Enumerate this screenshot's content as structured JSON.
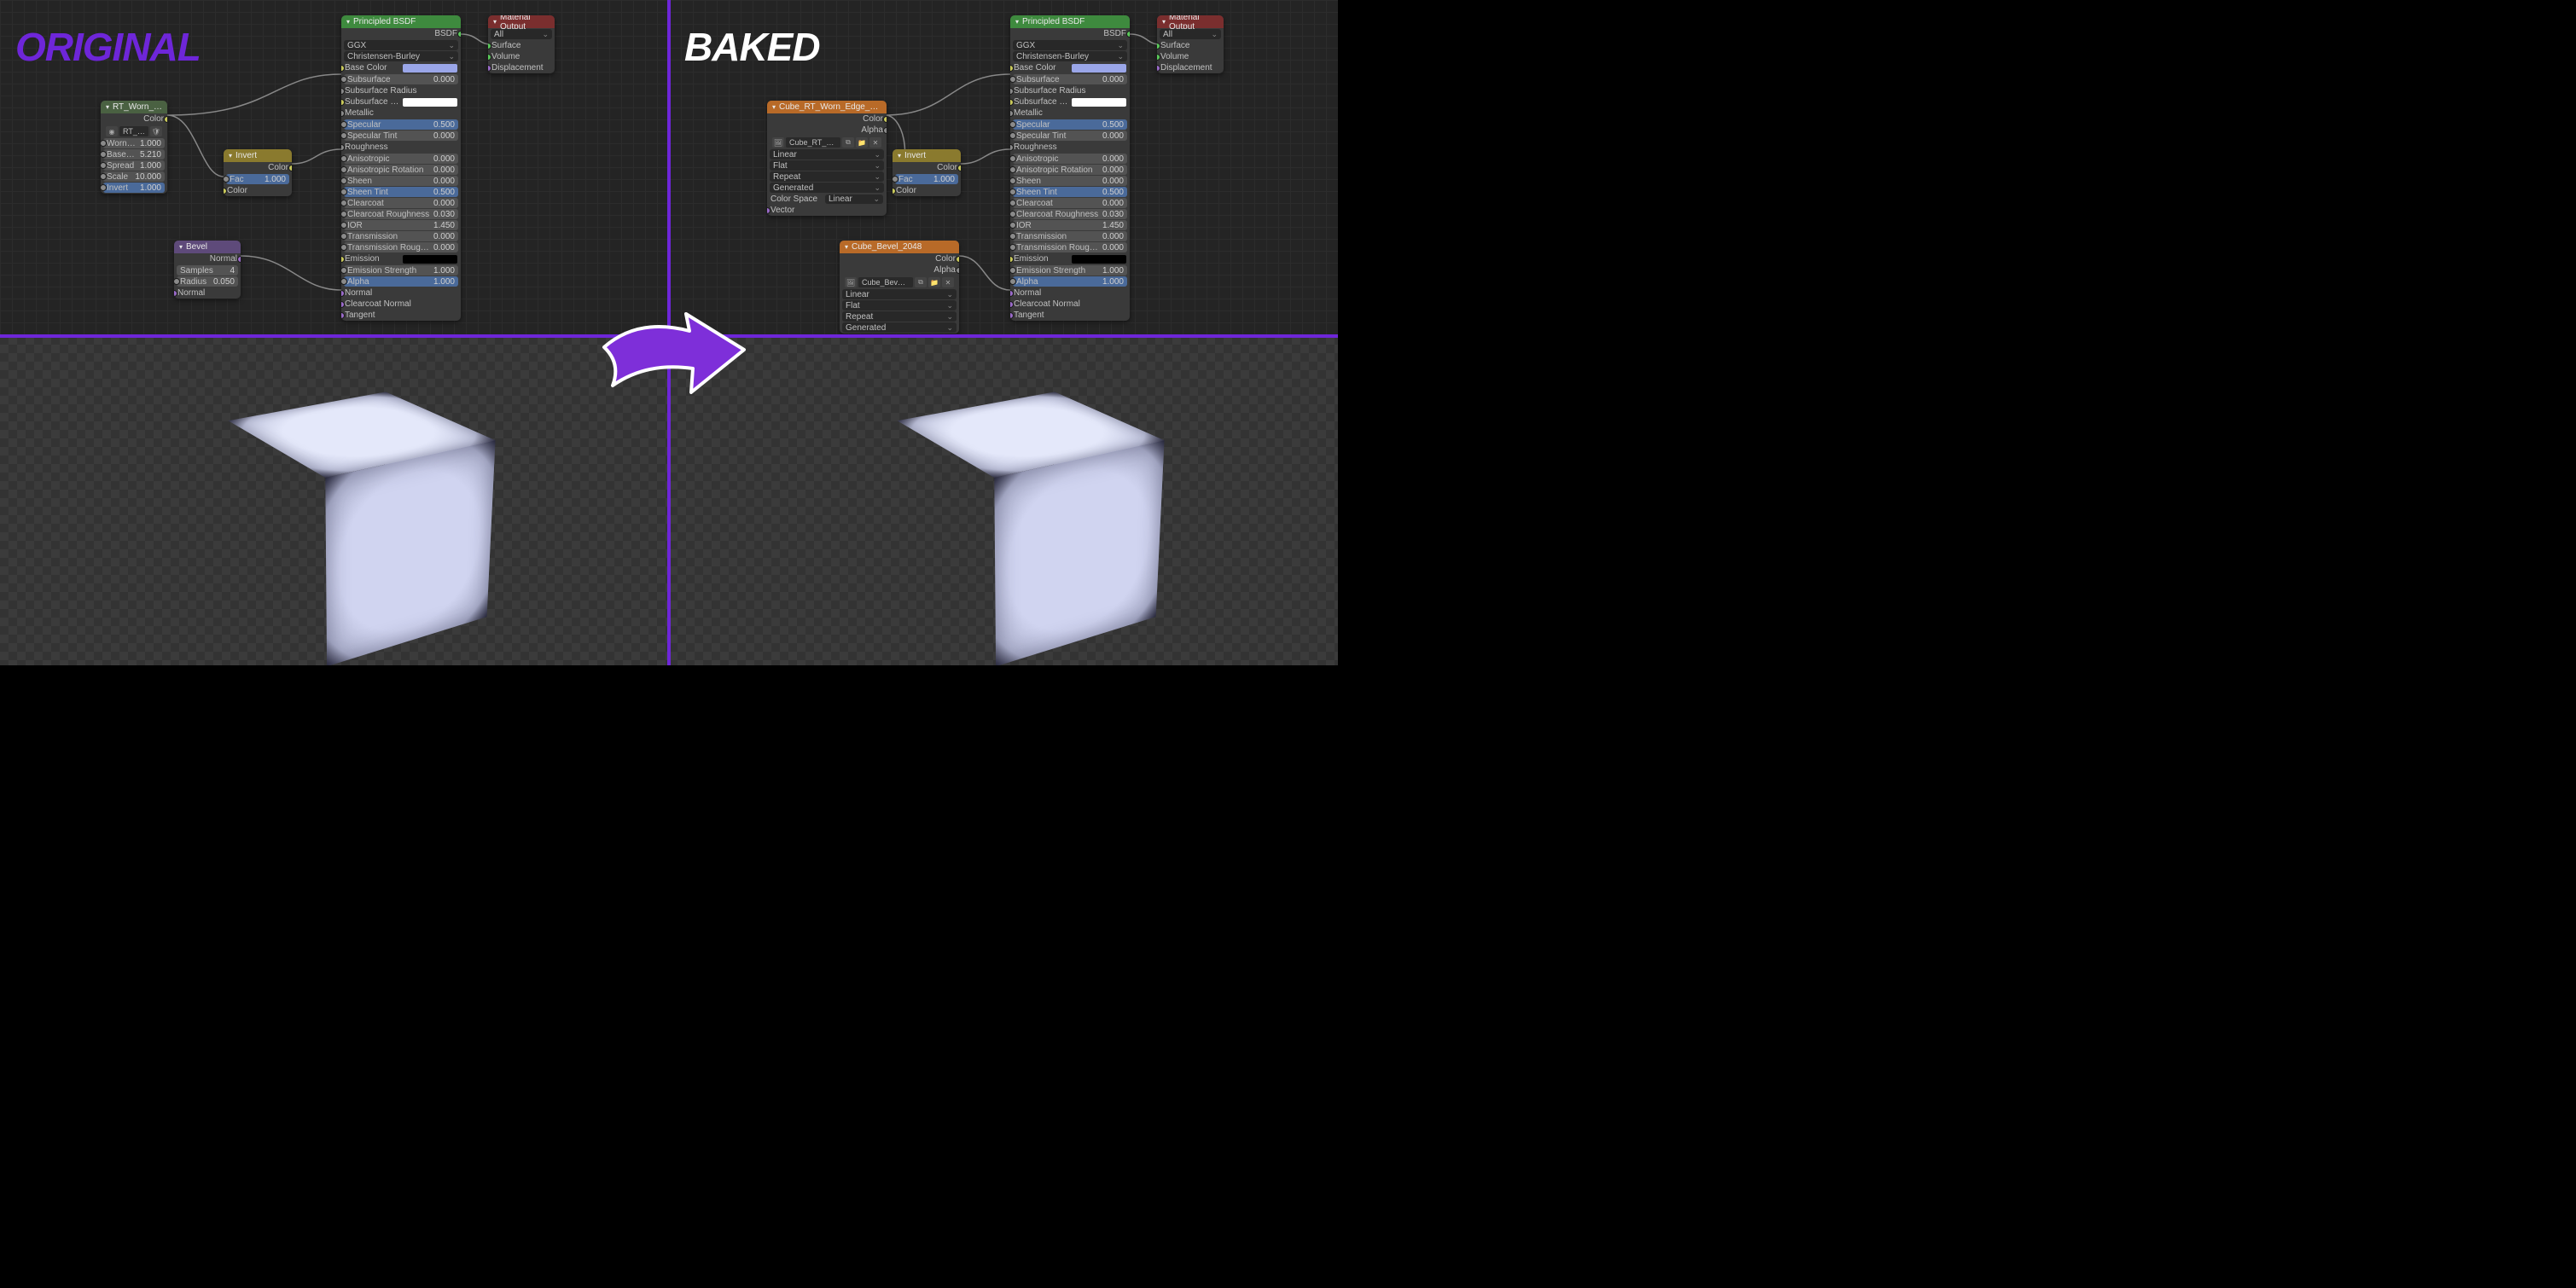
{
  "labels": {
    "original": "ORIGINAL",
    "baked": "BAKED"
  },
  "nodes": {
    "principled": {
      "title": "Principled BSDF",
      "bsdf_out": "BSDF",
      "distribution": "GGX",
      "sss_method": "Christensen-Burley",
      "props": [
        {
          "name": "Base Color",
          "type": "color",
          "color": "#9aa6e8"
        },
        {
          "name": "Subsurface",
          "type": "field",
          "value": "0.000"
        },
        {
          "name": "Subsurface Radius",
          "type": "socket"
        },
        {
          "name": "Subsurface C..",
          "type": "color",
          "color": "#ffffff"
        },
        {
          "name": "Metallic",
          "type": "socket"
        },
        {
          "name": "Specular",
          "type": "field",
          "value": "0.500",
          "blue": true
        },
        {
          "name": "Specular Tint",
          "type": "field",
          "value": "0.000"
        },
        {
          "name": "Roughness",
          "type": "socket"
        },
        {
          "name": "Anisotropic",
          "type": "field",
          "value": "0.000"
        },
        {
          "name": "Anisotropic Rotation",
          "type": "field",
          "value": "0.000"
        },
        {
          "name": "Sheen",
          "type": "field",
          "value": "0.000"
        },
        {
          "name": "Sheen Tint",
          "type": "field",
          "value": "0.500",
          "blue": true
        },
        {
          "name": "Clearcoat",
          "type": "field",
          "value": "0.000"
        },
        {
          "name": "Clearcoat Roughness",
          "type": "field",
          "value": "0.030"
        },
        {
          "name": "IOR",
          "type": "field",
          "value": "1.450"
        },
        {
          "name": "Transmission",
          "type": "field",
          "value": "0.000"
        },
        {
          "name": "Transmission Roughness",
          "type": "field",
          "value": "0.000"
        },
        {
          "name": "Emission",
          "type": "color",
          "color": "#000000"
        },
        {
          "name": "Emission Strength",
          "type": "field",
          "value": "1.000"
        },
        {
          "name": "Alpha",
          "type": "field",
          "value": "1.000",
          "blue": true
        },
        {
          "name": "Normal",
          "type": "socket"
        },
        {
          "name": "Clearcoat Normal",
          "type": "socket"
        },
        {
          "name": "Tangent",
          "type": "socket"
        }
      ]
    },
    "material_output": {
      "title": "Material Output",
      "target": "All",
      "inputs": [
        "Surface",
        "Volume",
        "Displacement"
      ]
    },
    "invert": {
      "title": "Invert",
      "color_out": "Color",
      "fac": {
        "label": "Fac",
        "value": "1.000"
      },
      "color_in": "Color"
    },
    "worn_edge_group": {
      "title": "RT_Worn_Edge...",
      "datablock": "RT_Worn...",
      "color_out": "Color",
      "props": [
        {
          "name": "Worn Eff",
          "value": "1.000"
        },
        {
          "name": "Base Wi",
          "value": "5.210"
        },
        {
          "name": "Spread",
          "value": "1.000"
        },
        {
          "name": "Scale",
          "value": "10.000"
        },
        {
          "name": "Invert",
          "value": "1.000",
          "blue": true
        }
      ]
    },
    "bevel": {
      "title": "Bevel",
      "normal_out": "Normal",
      "samples": {
        "label": "Samples",
        "value": "4"
      },
      "radius": {
        "label": "Radius",
        "value": "0.050"
      },
      "normal_in": "Normal"
    },
    "tex_mask": {
      "title": "Cube_RT_Worn_Edge_Mask_2048",
      "color_out": "Color",
      "alpha_out": "Alpha",
      "image": "Cube_RT_Worn...",
      "interp": "Linear",
      "projection": "Flat",
      "extension": "Repeat",
      "source": "Generated",
      "colorspace_label": "Color Space",
      "colorspace": "Linear",
      "vector_in": "Vector"
    },
    "tex_bevel": {
      "title": "Cube_Bevel_2048",
      "color_out": "Color",
      "alpha_out": "Alpha",
      "image": "Cube_Bevel_20...",
      "interp": "Linear",
      "projection": "Flat",
      "extension": "Repeat",
      "source": "Generated"
    }
  }
}
